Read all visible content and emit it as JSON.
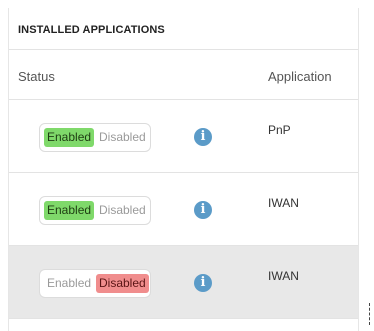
{
  "section": {
    "title": "INSTALLED APPLICATIONS"
  },
  "columns": {
    "status": "Status",
    "application": "Application"
  },
  "toggle_labels": {
    "enabled": "Enabled",
    "disabled": "Disabled"
  },
  "info_icon": {
    "glyph": "i",
    "icon": "info-icon"
  },
  "rows": [
    {
      "app": "PnP",
      "state": "Enabled",
      "selected": false
    },
    {
      "app": "IWAN",
      "state": "Enabled",
      "selected": false
    },
    {
      "app": "IWAN",
      "state": "Disabled",
      "selected": true
    }
  ],
  "colors": {
    "enabled": "#7fd96a",
    "disabled": "#f08d8d",
    "info": "#5b9bc8",
    "selected_row": "#e8e8e8"
  }
}
